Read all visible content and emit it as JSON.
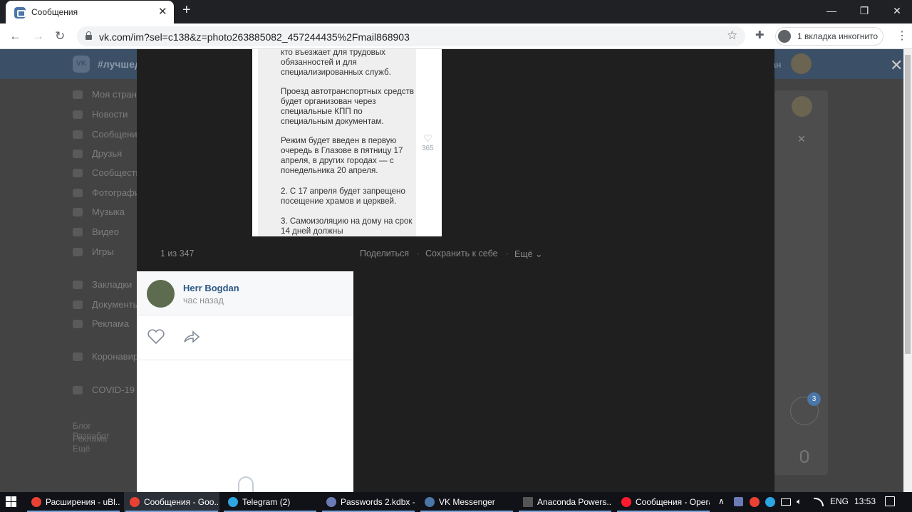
{
  "browser": {
    "tab_title": "Сообщения",
    "tab_close": "✕",
    "new_tab": "+",
    "url": "vk.com/im?sel=c138&z=photo263885082_457244435%2Fmail868903",
    "incognito_label": "1 вкладка инкогнито",
    "back": "←",
    "forward": "→",
    "reload": "↻",
    "star": "☆",
    "ext": "✚",
    "menu": "⋮",
    "min": "—",
    "max": "❐",
    "close": "✕"
  },
  "vk": {
    "logo": "VK",
    "search_text": "#лучшед",
    "user_text": "ан",
    "close_x": "✕",
    "sidebar": [
      "Моя страница",
      "Новости",
      "Сообщения",
      "Друзья",
      "Сообщества",
      "Фотографии",
      "Музыка",
      "Видео",
      "Игры",
      "Закладки",
      "Документы",
      "Реклама",
      "Коронавирус",
      "COVID-19"
    ],
    "footer_1": "Блог   Разработ",
    "footer_2": "Реклама   Ещё"
  },
  "viewer": {
    "paragraphs": [
      "кто въезжает для трудовых обязанностей и для специализированных служб.",
      "Проезд автотранспортных средств будет организован через специальные КПП по специальным документам.",
      "Режим будет введен в первую очередь в Глазове в пятницу 17 апреля, в других городах — с понедельника 20 апреля.",
      "2. С 17 апреля будет запрещено посещение храмов и церквей.",
      "3. Самоизоляцию на дому на срок 14 дней должны"
    ],
    "like_count": "365",
    "counter": "1 из 347",
    "share": "Поделиться",
    "save": "Сохранить к себе",
    "more": "Ещё ⌄",
    "sep": "·"
  },
  "panel": {
    "author": "Herr Bogdan",
    "time": "час назад"
  },
  "badge": "3",
  "taskbar": {
    "items": [
      "Расширения - uBl...",
      "Сообщения - Goo...",
      "Telegram (2)",
      "Passwords 2.kdbx -...",
      "VK Messenger",
      "Anaconda Powers...",
      "Сообщения - Opera"
    ],
    "lang": "ENG",
    "time": "13:53",
    "caret": "∧"
  },
  "colors": {
    "vk_blue": "#4a76a8",
    "link": "#2a5885",
    "chrome_dark": "#202124"
  }
}
